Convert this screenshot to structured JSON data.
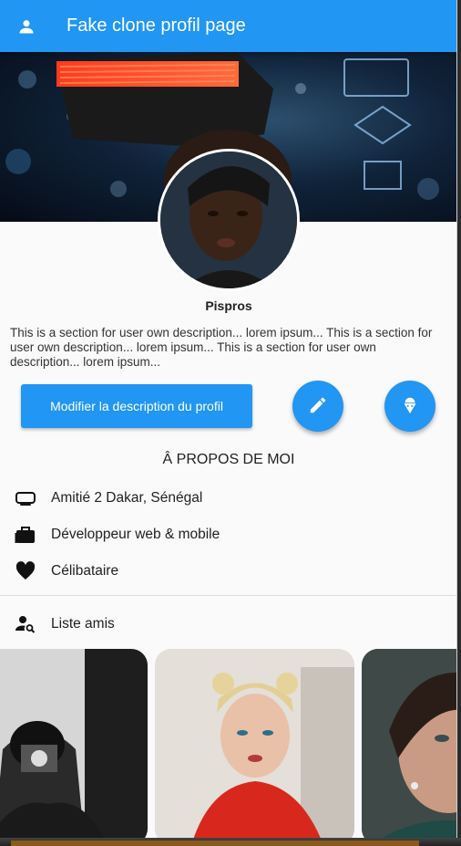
{
  "appbar": {
    "title": "Fake clone profil page",
    "icon": "person-icon"
  },
  "profile": {
    "name": "Pispros",
    "description": "This is a section for user own description... lorem ipsum... This is a section for user own description... lorem ipsum... This is a section for user own description... lorem ipsum..."
  },
  "actions": {
    "edit_description_label": "Modifier la description du profil",
    "edit_fab_icon": "pencil-icon",
    "icecream_fab_icon": "ice-cream-icon"
  },
  "about": {
    "title": "Â PROPOS DE MOI",
    "items": [
      {
        "icon": "location-tv-icon",
        "text": "Amitié 2 Dakar, Sénégal"
      },
      {
        "icon": "briefcase-icon",
        "text": "Développeur web & mobile"
      },
      {
        "icon": "heart-icon",
        "text": "Célibataire"
      }
    ]
  },
  "friends": {
    "label": "Liste amis",
    "icon": "person-search-icon"
  },
  "colors": {
    "primary": "#2196f3",
    "background": "#fafafa"
  }
}
